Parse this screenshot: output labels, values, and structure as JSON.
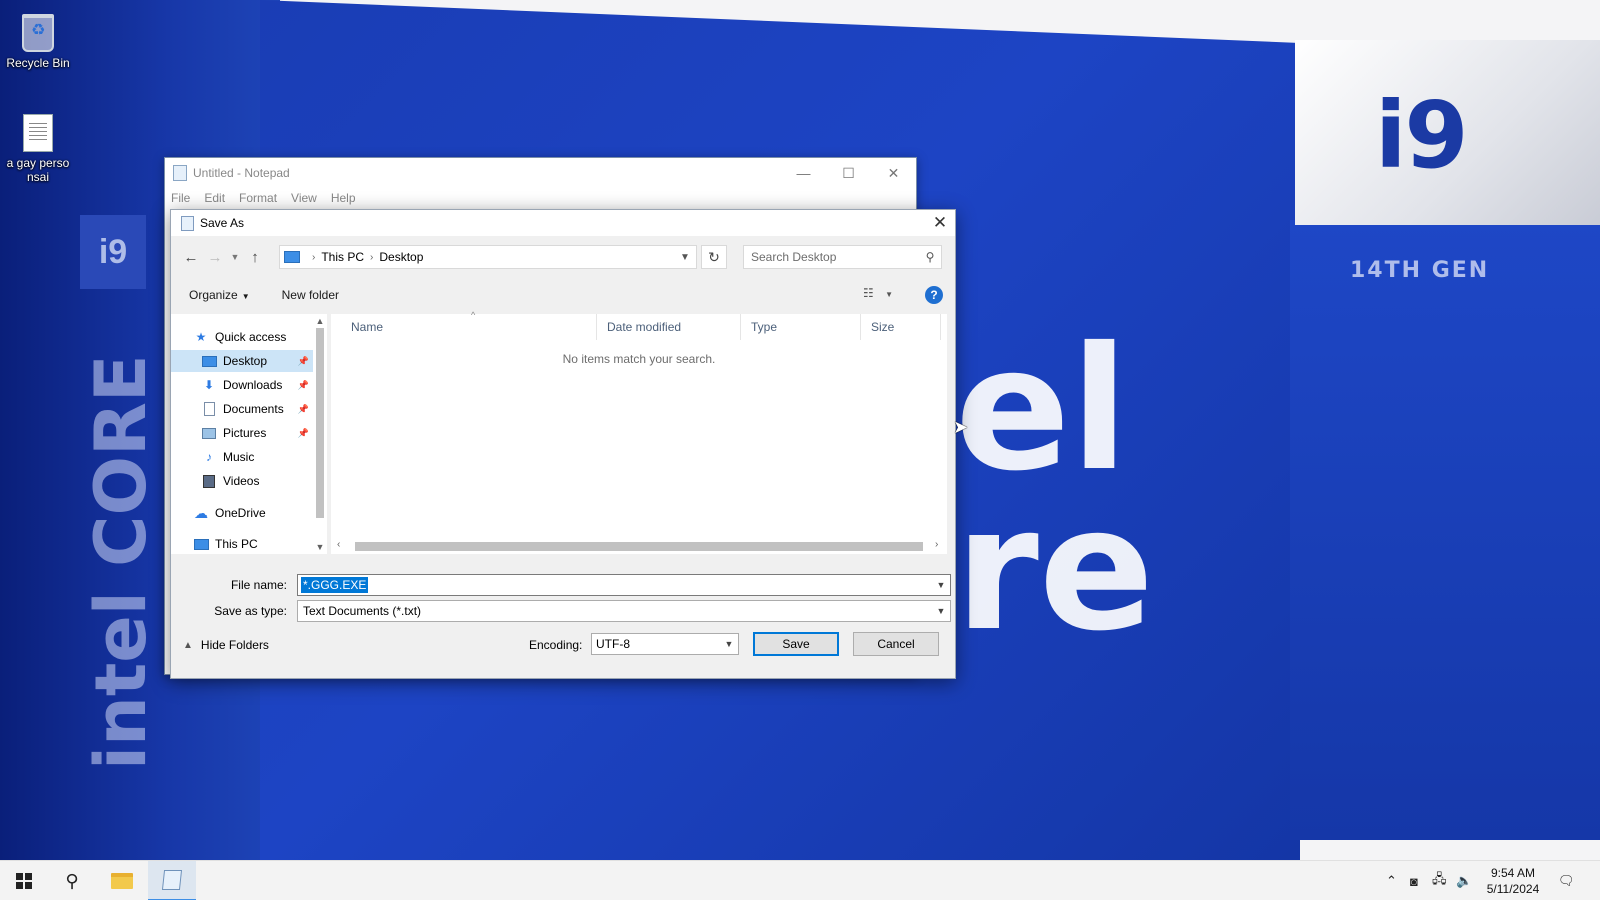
{
  "desktop": {
    "icons": [
      {
        "label": "Recycle Bin"
      },
      {
        "label": "a gay perso nsai"
      }
    ],
    "wallpaper": {
      "brand_large": "i9",
      "generation": "14TH GEN",
      "side_badge": "i9",
      "vertical_brand": "intel CORE",
      "logo_fragment": "el\nre"
    }
  },
  "notepad": {
    "title": "Untitled - Notepad",
    "menu": [
      "File",
      "Edit",
      "Format",
      "View",
      "Help"
    ]
  },
  "dialog": {
    "title": "Save As",
    "breadcrumb": [
      "This PC",
      "Desktop"
    ],
    "search_placeholder": "Search Desktop",
    "toolbar": {
      "organize": "Organize",
      "new_folder": "New folder"
    },
    "nav": {
      "quick_access": "Quick access",
      "items": [
        {
          "label": "Desktop",
          "pinned": true,
          "selected": true,
          "icon": "desktop-icon"
        },
        {
          "label": "Downloads",
          "pinned": true,
          "icon": "download-icon"
        },
        {
          "label": "Documents",
          "pinned": true,
          "icon": "documents-icon"
        },
        {
          "label": "Pictures",
          "pinned": true,
          "icon": "pictures-icon"
        },
        {
          "label": "Music",
          "pinned": false,
          "icon": "music-icon"
        },
        {
          "label": "Videos",
          "pinned": false,
          "icon": "videos-icon"
        }
      ],
      "onedrive": "OneDrive",
      "this_pc": "This PC"
    },
    "columns": [
      "Name",
      "Date modified",
      "Type",
      "Size"
    ],
    "empty_message": "No items match your search.",
    "file_name_label": "File name:",
    "file_name_value": "*.GGG.EXE",
    "save_type_label": "Save as type:",
    "save_type_value": "Text Documents (*.txt)",
    "hide_folders": "Hide Folders",
    "encoding_label": "Encoding:",
    "encoding_value": "UTF-8",
    "save_button": "Save",
    "cancel_button": "Cancel"
  },
  "taskbar": {
    "time": "9:54 AM",
    "date": "5/11/2024"
  },
  "colors": {
    "accent": "#0078d7",
    "selection": "#cce4f7",
    "wallpaper_blue": "#1d44c4"
  }
}
